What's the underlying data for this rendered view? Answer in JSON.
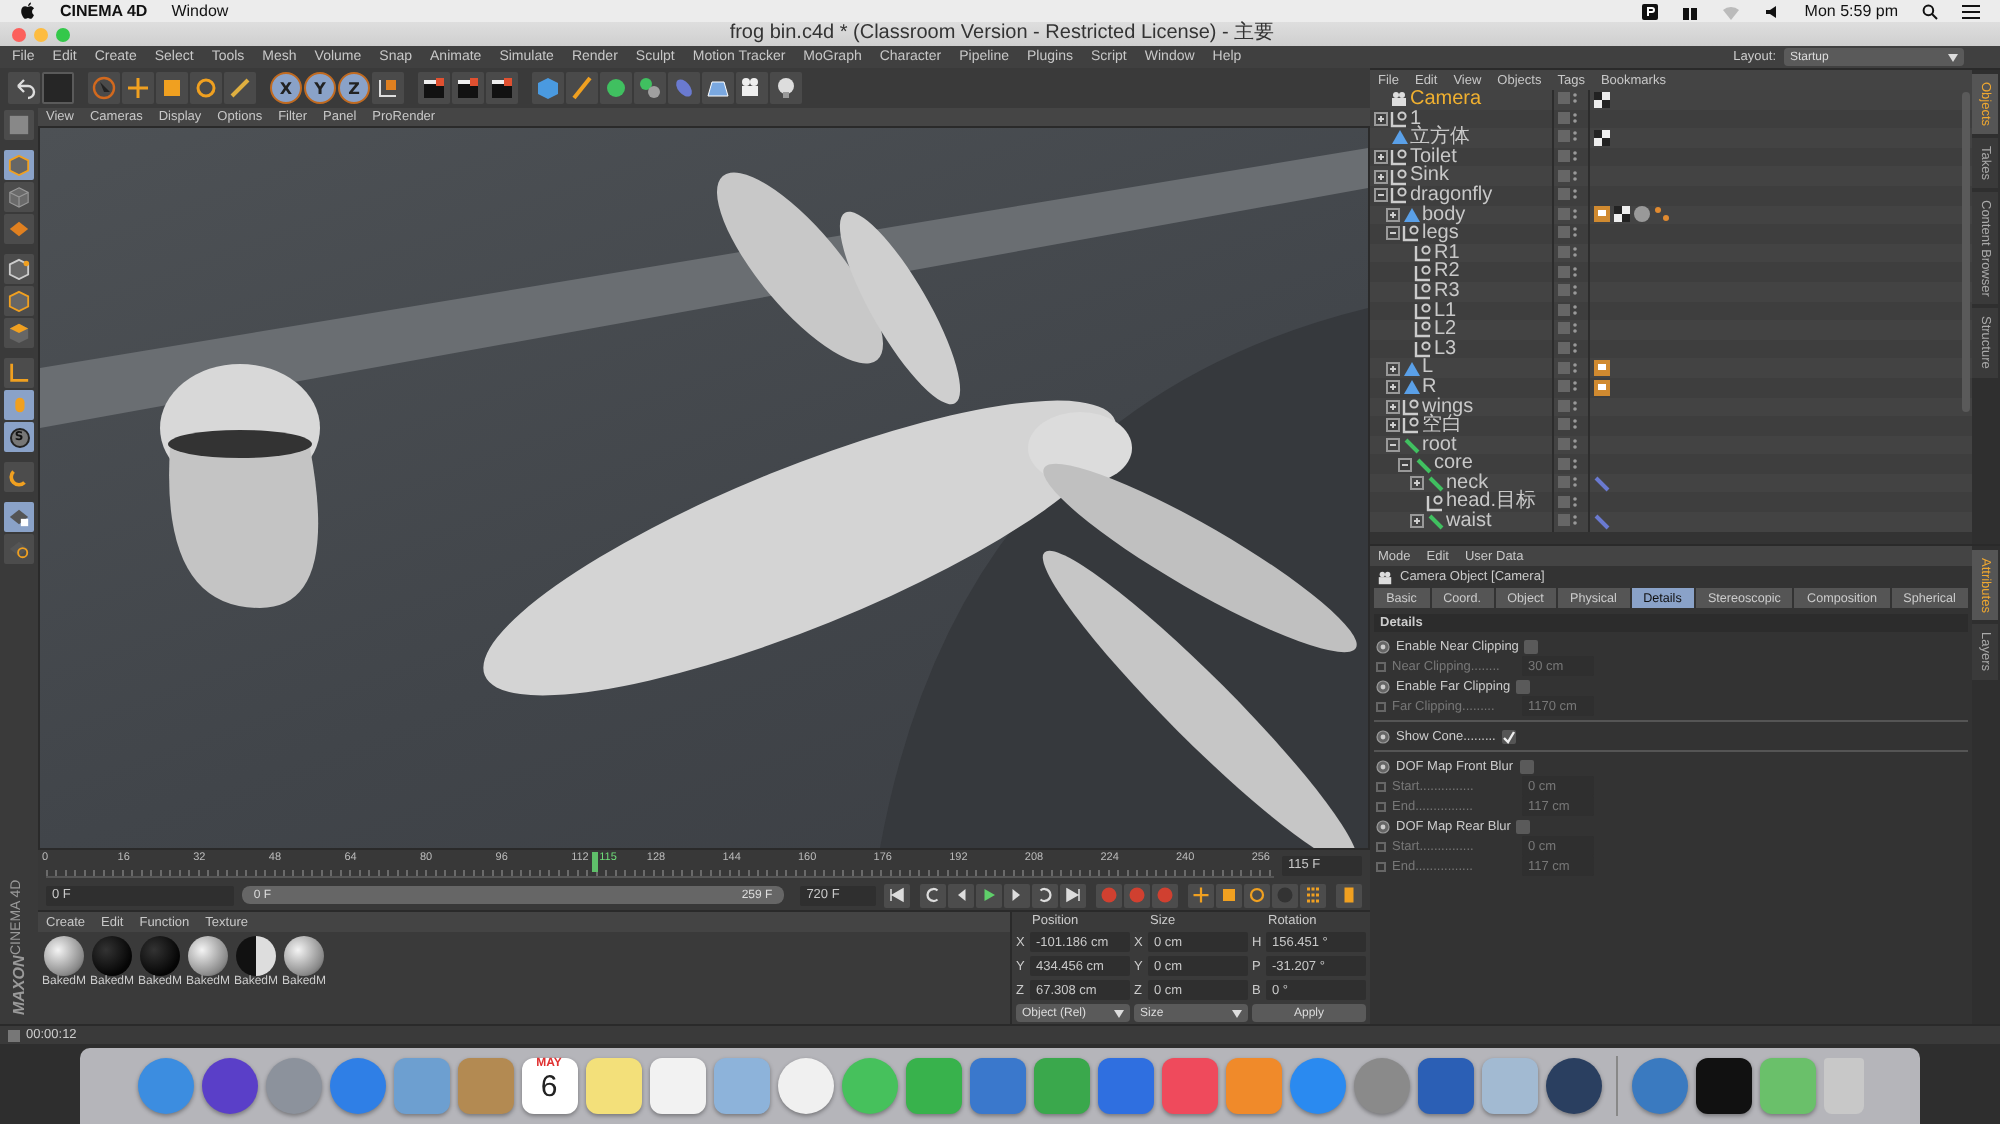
{
  "menu_bar": {
    "app": "CINEMA 4D",
    "items": [
      "Window"
    ],
    "clock": "Mon 5:59 pm"
  },
  "window": {
    "title": "frog bin.c4d * (Classroom Version - Restricted License) - 主要"
  },
  "main_menu": [
    "File",
    "Edit",
    "Create",
    "Select",
    "Tools",
    "Mesh",
    "Volume",
    "Snap",
    "Animate",
    "Simulate",
    "Render",
    "Sculpt",
    "Motion Tracker",
    "MoGraph",
    "Character",
    "Pipeline",
    "Plugins",
    "Script",
    "Window",
    "Help"
  ],
  "toolbar": [
    {
      "kind": "undo",
      "selected": false
    },
    {
      "kind": "slot",
      "selected": false
    },
    {
      "kind": "select",
      "selected": false
    },
    {
      "kind": "move",
      "selected": false
    },
    {
      "kind": "scale",
      "selected": false
    },
    {
      "kind": "rotate",
      "selected": false
    },
    {
      "kind": "brush",
      "selected": false
    },
    {
      "kind": "axis",
      "label": "X",
      "selected": true
    },
    {
      "kind": "axis",
      "label": "Y",
      "selected": true
    },
    {
      "kind": "axis",
      "label": "Z",
      "selected": true
    },
    {
      "kind": "coords",
      "selected": false
    },
    {
      "kind": "render",
      "selected": false
    },
    {
      "kind": "render",
      "selected": false
    },
    {
      "kind": "render",
      "selected": false
    },
    {
      "kind": "cube",
      "selected": false
    },
    {
      "kind": "pen",
      "selected": false
    },
    {
      "kind": "sphere",
      "selected": false
    },
    {
      "kind": "spheres",
      "selected": false
    },
    {
      "kind": "capsule",
      "selected": false
    },
    {
      "kind": "floor",
      "selected": false
    },
    {
      "kind": "camera",
      "selected": false
    },
    {
      "kind": "bulb",
      "selected": false
    }
  ],
  "layout": {
    "label": "Layout:",
    "value": "Startup"
  },
  "left_tools": [
    {
      "kind": "texture",
      "selected": false
    },
    {
      "kind": "model",
      "selected": true
    },
    {
      "kind": "uv",
      "selected": false
    },
    {
      "kind": "grid",
      "selected": false
    },
    {
      "kind": "points",
      "selected": false
    },
    {
      "kind": "edges",
      "selected": false
    },
    {
      "kind": "polygons",
      "selected": false
    },
    {
      "kind": "axis",
      "selected": false
    },
    {
      "kind": "tweak",
      "selected": true
    },
    {
      "kind": "snap",
      "label": "S",
      "selected": true
    },
    {
      "kind": "magnet",
      "selected": false
    },
    {
      "kind": "lock",
      "selected": true
    },
    {
      "kind": "workplane",
      "selected": false
    }
  ],
  "viewport": {
    "menu": [
      "View",
      "Cameras",
      "Display",
      "Options",
      "Filter",
      "Panel",
      "ProRender"
    ]
  },
  "object_manager": {
    "menu": [
      "File",
      "Edit",
      "View",
      "Objects",
      "Tags",
      "Bookmarks"
    ],
    "tabs": [
      {
        "label": "Objects",
        "selected": true
      },
      {
        "label": "Takes",
        "selected": false
      },
      {
        "label": "Content Browser",
        "selected": false
      },
      {
        "label": "Structure",
        "selected": false
      }
    ],
    "objects": [
      {
        "name": "Camera",
        "kind": "camera",
        "selected": true,
        "tags": [
          {
            "kind": "checker"
          }
        ]
      },
      {
        "name": "1",
        "kind": "null",
        "selected": false,
        "expanded": false
      },
      {
        "name": "立方体",
        "kind": "polygon",
        "selected": false,
        "tags": [
          {
            "kind": "checker"
          }
        ]
      },
      {
        "name": "Toilet",
        "kind": "null",
        "selected": false,
        "expanded": false
      },
      {
        "name": "Sink",
        "kind": "null",
        "selected": false,
        "expanded": false
      },
      {
        "name": "dragonfly",
        "kind": "null",
        "selected": false,
        "expanded": true,
        "children": [
          {
            "name": "body",
            "kind": "polygon",
            "selected": false,
            "expanded": false,
            "tags": [
              {
                "kind": "weight"
              },
              {
                "kind": "checker"
              },
              {
                "kind": "material"
              },
              {
                "kind": "points"
              }
            ]
          },
          {
            "name": "legs",
            "kind": "null",
            "selected": false,
            "expanded": true,
            "children": [
              {
                "name": "R1",
                "kind": "null",
                "selected": false
              },
              {
                "name": "R2",
                "kind": "null",
                "selected": false
              },
              {
                "name": "R3",
                "kind": "null",
                "selected": false
              },
              {
                "name": "L1",
                "kind": "null",
                "selected": false
              },
              {
                "name": "L2",
                "kind": "null",
                "selected": false
              },
              {
                "name": "L3",
                "kind": "null",
                "selected": false
              }
            ]
          },
          {
            "name": "L",
            "kind": "polygon",
            "selected": false,
            "expanded": false,
            "tags": [
              {
                "kind": "weight"
              }
            ]
          },
          {
            "name": "R",
            "kind": "polygon",
            "selected": false,
            "expanded": false,
            "tags": [
              {
                "kind": "weight"
              }
            ]
          },
          {
            "name": "wings",
            "kind": "null",
            "selected": false,
            "expanded": false
          },
          {
            "name": "空白",
            "kind": "null",
            "selected": false,
            "expanded": false
          },
          {
            "name": "root",
            "kind": "joint",
            "selected": false,
            "expanded": true,
            "children": [
              {
                "name": "core",
                "kind": "joint",
                "selected": false,
                "expanded": true,
                "children": [
                  {
                    "name": "neck",
                    "kind": "joint",
                    "selected": false,
                    "expanded": false,
                    "tags": [
                      {
                        "kind": "ik"
                      }
                    ]
                  },
                  {
                    "name": "head.目标",
                    "kind": "null",
                    "selected": false
                  },
                  {
                    "name": "waist",
                    "kind": "joint",
                    "selected": false,
                    "expanded": false,
                    "tags": [
                      {
                        "kind": "ik"
                      }
                    ]
                  }
                ]
              }
            ]
          }
        ]
      }
    ]
  },
  "attributes": {
    "menu": [
      "Mode",
      "Edit",
      "User Data"
    ],
    "title": "Camera Object [Camera]",
    "side_tabs": [
      {
        "label": "Attributes",
        "selected": true
      },
      {
        "label": "Layers",
        "selected": false
      }
    ],
    "tabs": [
      {
        "label": "Basic",
        "selected": false
      },
      {
        "label": "Coord.",
        "selected": false
      },
      {
        "label": "Object",
        "selected": false
      },
      {
        "label": "Physical",
        "selected": false
      },
      {
        "label": "Details",
        "selected": true
      },
      {
        "label": "Stereoscopic",
        "selected": false
      },
      {
        "label": "Composition",
        "selected": false
      },
      {
        "label": "Spherical",
        "selected": false
      }
    ],
    "section": "Details",
    "rows": [
      {
        "kind": "checkbox",
        "label": "Enable Near Clipping",
        "checked": false
      },
      {
        "kind": "field",
        "label": "Near Clipping........",
        "value": "30 cm",
        "disabled": true
      },
      {
        "kind": "checkbox",
        "label": "Enable Far Clipping",
        "checked": false
      },
      {
        "kind": "field",
        "label": "Far Clipping.........",
        "value": "1170 cm",
        "disabled": true
      },
      {
        "kind": "separator"
      },
      {
        "kind": "checkbox",
        "label": "Show Cone.........",
        "checked": true
      },
      {
        "kind": "separator"
      },
      {
        "kind": "checkbox",
        "label": "DOF Map Front Blur",
        "checked": false
      },
      {
        "kind": "field",
        "label": "Start...............",
        "value": "0 cm",
        "disabled": true
      },
      {
        "kind": "field",
        "label": "End................",
        "value": "117 cm",
        "disabled": true
      },
      {
        "kind": "checkbox",
        "label": "DOF Map Rear Blur",
        "checked": false
      },
      {
        "kind": "field",
        "label": "Start...............",
        "value": "0 cm",
        "disabled": true
      },
      {
        "kind": "field",
        "label": "End................",
        "value": "117 cm",
        "disabled": true
      }
    ]
  },
  "timeline": {
    "ticks": [
      "0",
      "16",
      "32",
      "48",
      "64",
      "80",
      "96",
      "112",
      "128",
      "144",
      "160",
      "176",
      "192",
      "208",
      "224",
      "240",
      "256"
    ],
    "playhead": {
      "label": "115",
      "level": 0.444
    },
    "current": "115 F",
    "start": "0 F",
    "range": {
      "start": "0 F",
      "end": "259 F",
      "level": 1
    },
    "end": "720 F"
  },
  "materials": {
    "menu": [
      "Create",
      "Edit",
      "Function",
      "Texture"
    ],
    "items": [
      {
        "name": "BakedM",
        "kind": "light"
      },
      {
        "name": "BakedM",
        "kind": "dark"
      },
      {
        "name": "BakedM",
        "kind": "dark"
      },
      {
        "name": "BakedM",
        "kind": "light"
      },
      {
        "name": "BakedM",
        "kind": "half"
      },
      {
        "name": "BakedM",
        "kind": "light"
      }
    ]
  },
  "coordinates": {
    "headers": [
      "Position",
      "Size",
      "Rotation"
    ],
    "rows": [
      {
        "cells": [
          {
            "axis": "X",
            "value": "-101.186 cm"
          },
          {
            "axis": "X",
            "value": "0 cm"
          },
          {
            "axis": "H",
            "value": "156.451 °"
          }
        ]
      },
      {
        "cells": [
          {
            "axis": "Y",
            "value": "434.456 cm"
          },
          {
            "axis": "Y",
            "value": "0 cm"
          },
          {
            "axis": "P",
            "value": "-31.207 °"
          }
        ]
      },
      {
        "cells": [
          {
            "axis": "Z",
            "value": "67.308 cm"
          },
          {
            "axis": "Z",
            "value": "0 cm"
          },
          {
            "axis": "B",
            "value": "0 °"
          }
        ]
      }
    ],
    "mode": "Object (Rel)",
    "size_mode": "Size",
    "apply": "Apply"
  },
  "logo": {
    "brand": "MAXON",
    "product": "CINEMA 4D"
  },
  "status_bar": {
    "time": "00:00:12"
  },
  "dock": [
    {
      "kind": "round",
      "color": "#3c8de0"
    },
    {
      "kind": "round",
      "color": "#5a3fc8"
    },
    {
      "kind": "round",
      "color": "#8c929c"
    },
    {
      "kind": "round",
      "color": "#2f7fe6"
    },
    {
      "kind": "app",
      "color": "#6d9fd0"
    },
    {
      "kind": "app",
      "color": "#b38a52"
    },
    {
      "kind": "calendar",
      "color": "#ffffff",
      "month": "MAY",
      "day": "6"
    },
    {
      "kind": "app",
      "color": "#f3e07a"
    },
    {
      "kind": "app",
      "color": "#f2f2f2"
    },
    {
      "kind": "app",
      "color": "#8db3da"
    },
    {
      "kind": "round",
      "color": "#f0f0f0"
    },
    {
      "kind": "round",
      "color": "#46c15c"
    },
    {
      "kind": "app",
      "color": "#38b24c"
    },
    {
      "kind": "app",
      "color": "#3a78cc"
    },
    {
      "kind": "app",
      "color": "#3aa84c"
    },
    {
      "kind": "app",
      "color": "#2f6fe0"
    },
    {
      "kind": "app",
      "color": "#ef4a5c"
    },
    {
      "kind": "app",
      "color": "#f08a2a"
    },
    {
      "kind": "round",
      "color": "#2a8af0"
    },
    {
      "kind": "round",
      "color": "#8a8a8a"
    },
    {
      "kind": "app",
      "color": "#2b5fb5"
    },
    {
      "kind": "app",
      "color": "#a2bad2"
    },
    {
      "kind": "round",
      "color": "#2a3f60"
    },
    {
      "kind": "separator"
    },
    {
      "kind": "round",
      "color": "#3a7ac0"
    },
    {
      "kind": "app",
      "color": "#111111"
    },
    {
      "kind": "app",
      "color": "#6ac06a"
    },
    {
      "kind": "trash",
      "color": "#c8c8c8"
    }
  ]
}
